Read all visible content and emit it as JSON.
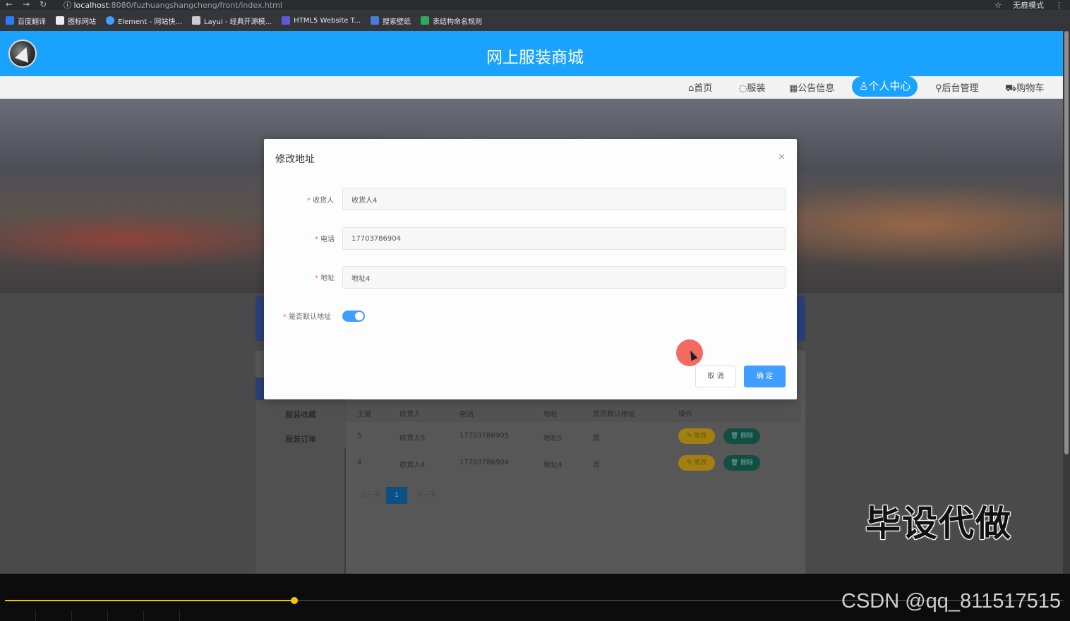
{
  "browser": {
    "url_host": "localhost",
    "url_path": ":8080/fuzhuangshangcheng/front/index.html",
    "profile_label": "无痕模式",
    "bookmarks": [
      {
        "label": "百度翻译",
        "icon": "translate-icon",
        "color": "#2b7cf6"
      },
      {
        "label": "图标网站",
        "icon": "flag-icon",
        "color": "#eeeeee"
      },
      {
        "label": "Element - 网站快...",
        "icon": "element-icon",
        "color": "#409eff"
      },
      {
        "label": "Layui - 经典开源模...",
        "icon": "layui-icon",
        "color": "#cccccc"
      },
      {
        "label": "HTML5 Website T...",
        "icon": "html5-icon",
        "color": "#5b5bd6"
      },
      {
        "label": "搜索壁纸",
        "icon": "wallpaper-icon",
        "color": "#4a7bd6"
      },
      {
        "label": "表结构命名规则",
        "icon": "table-icon",
        "color": "#2faa5a"
      }
    ]
  },
  "site": {
    "title": "网上服装商城",
    "nav": [
      {
        "label": "首页",
        "icon": "home-icon"
      },
      {
        "label": "服装",
        "icon": "clothes-icon"
      },
      {
        "label": "公告信息",
        "icon": "notice-icon"
      },
      {
        "label": "个人中心",
        "icon": "user-icon",
        "active": true
      },
      {
        "label": "后台管理",
        "icon": "link-icon"
      },
      {
        "label": "购物车",
        "icon": "cart-icon"
      }
    ]
  },
  "sidebar": {
    "items": [
      "服装收藏",
      "服装订单"
    ]
  },
  "table": {
    "headers": [
      "主键",
      "收货人",
      "电话",
      "地址",
      "是否默认地址",
      "操作"
    ],
    "rows": [
      {
        "id": "5",
        "name": "收货人5",
        "phone": "17703786905",
        "address": "地址5",
        "default": "是"
      },
      {
        "id": "4",
        "name": "收货人4",
        "phone": "17703786904",
        "address": "地址4",
        "default": "否"
      }
    ],
    "edit_label": "✎ 修改",
    "delete_label": "🗑 删除",
    "pager": {
      "prev": "上一页",
      "current": "1",
      "next": "下一页"
    }
  },
  "modal": {
    "title": "修改地址",
    "close": "×",
    "fields": {
      "receiver": {
        "label": "收货人",
        "value": "收货人4"
      },
      "phone": {
        "label": "电话",
        "value": "17703786904"
      },
      "address": {
        "label": "地址",
        "value": "地址4"
      },
      "is_default": {
        "label": "是否默认地址",
        "on": true
      }
    },
    "cancel_label": "取 消",
    "ok_label": "确 定"
  },
  "overlay": {
    "watermark": "毕设代做",
    "csdn": "CSDN @qq_811517515"
  },
  "player": {
    "progress": 0.273
  },
  "colors": {
    "brand": "#1aa2ff",
    "primary_button": "#409eff"
  }
}
